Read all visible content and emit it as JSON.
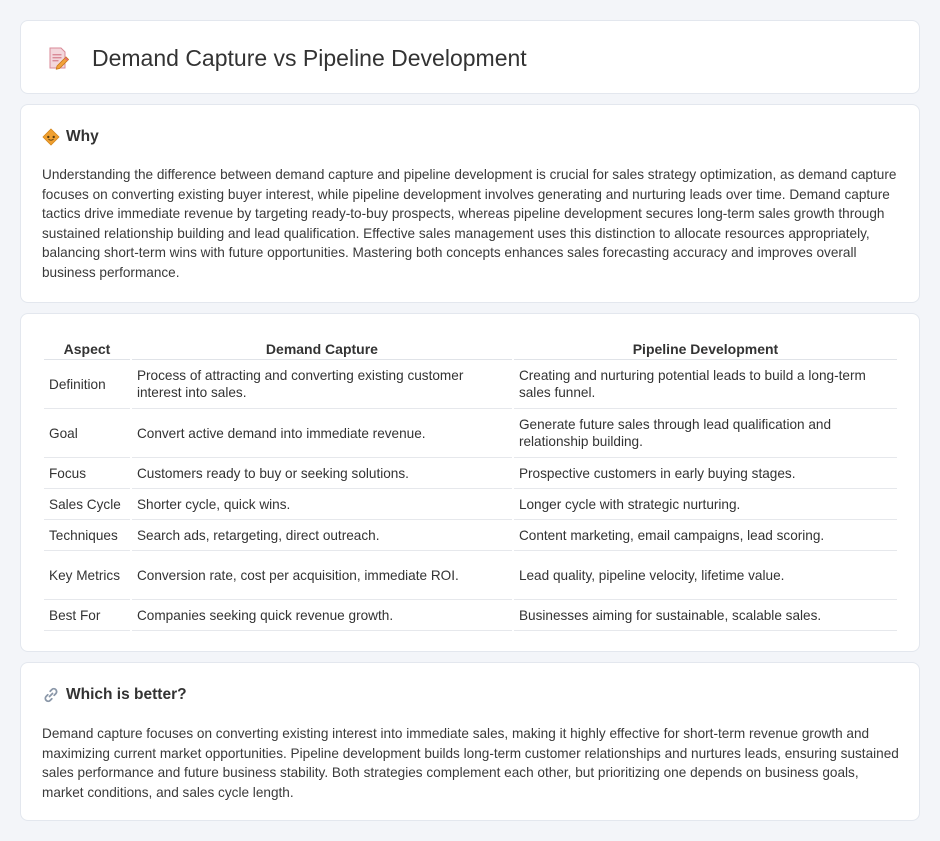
{
  "header": {
    "title": "Demand Capture vs Pipeline Development",
    "icon": "document-pencil-icon"
  },
  "why": {
    "heading": "Why",
    "icon": "diamond-sign-icon",
    "text": "Understanding the difference between demand capture and pipeline development is crucial for sales strategy optimization, as demand capture focuses on converting existing buyer interest, while pipeline development involves generating and nurturing leads over time. Demand capture tactics drive immediate revenue by targeting ready-to-buy prospects, whereas pipeline development secures long-term sales growth through sustained relationship building and lead qualification. Effective sales management uses this distinction to allocate resources appropriately, balancing short-term wins with future opportunities. Mastering both concepts enhances sales forecasting accuracy and improves overall business performance."
  },
  "comparison": {
    "headers": [
      "Aspect",
      "Demand Capture",
      "Pipeline Development"
    ],
    "rows": [
      [
        "Definition",
        "Process of attracting and converting existing customer interest into sales.",
        "Creating and nurturing potential leads to build a long-term sales funnel."
      ],
      [
        "Goal",
        "Convert active demand into immediate revenue.",
        "Generate future sales through lead qualification and relationship building."
      ],
      [
        "Focus",
        "Customers ready to buy or seeking solutions.",
        "Prospective customers in early buying stages."
      ],
      [
        "Sales Cycle",
        "Shorter cycle, quick wins.",
        "Longer cycle with strategic nurturing."
      ],
      [
        "Techniques",
        "Search ads, retargeting, direct outreach.",
        "Content marketing, email campaigns, lead scoring."
      ],
      [
        "Key Metrics",
        "Conversion rate, cost per acquisition, immediate ROI.",
        "Lead quality, pipeline velocity, lifetime value."
      ],
      [
        "Best For",
        "Companies seeking quick revenue growth.",
        "Businesses aiming for sustainable, scalable sales."
      ]
    ]
  },
  "better": {
    "heading": "Which is better?",
    "icon": "link-icon",
    "text": "Demand capture focuses on converting existing interest into immediate sales, making it highly effective for short-term revenue growth and maximizing current market opportunities. Pipeline development builds long-term customer relationships and nurtures leads, ensuring sustained sales performance and future business stability. Both strategies complement each other, but prioritizing one depends on business goals, market conditions, and sales cycle length."
  },
  "colors": {
    "background": "#f3f5f9",
    "card": "#ffffff",
    "icon_orange": "#f0a030",
    "icon_pink": "#e8667a"
  }
}
